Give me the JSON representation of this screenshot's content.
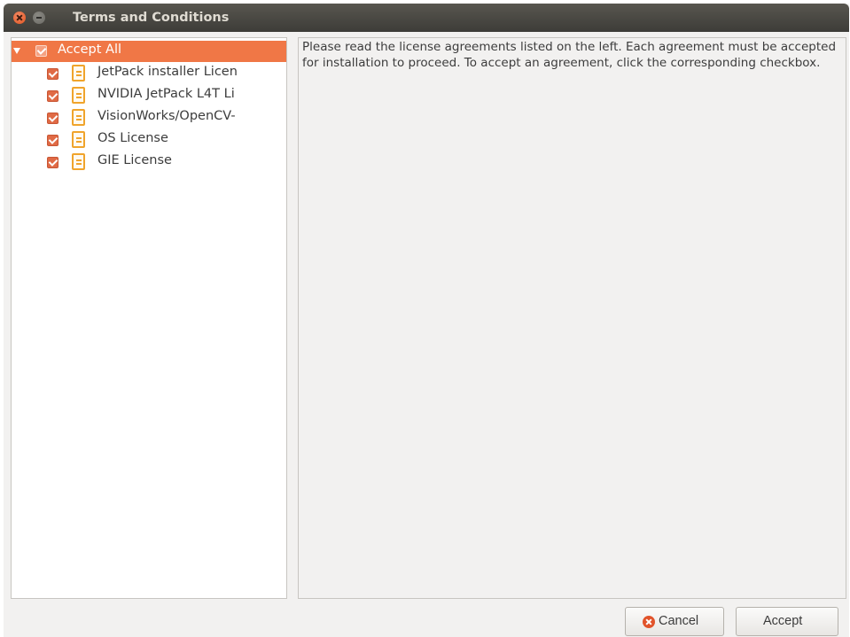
{
  "window": {
    "title": "Terms and Conditions"
  },
  "tree": {
    "root": {
      "label": "Accept All",
      "checked": true,
      "expanded": true,
      "selected": true
    },
    "items": [
      {
        "label": "JetPack installer Licen",
        "checked": true,
        "icon": "document-icon"
      },
      {
        "label": "NVIDIA JetPack L4T Li",
        "checked": true,
        "icon": "document-icon"
      },
      {
        "label": "VisionWorks/OpenCV-",
        "checked": true,
        "icon": "document-icon"
      },
      {
        "label": "OS License",
        "checked": true,
        "icon": "document-icon"
      },
      {
        "label": "GIE License",
        "checked": true,
        "icon": "document-icon"
      }
    ]
  },
  "info": {
    "text": "Please read the license agreements listed on the left. Each agreement must be accepted for installation to proceed. To accept an agreement, click the corresponding checkbox."
  },
  "buttons": {
    "cancel_label": "Cancel",
    "accept_label": "Accept"
  },
  "colors": {
    "accent": "#f07746",
    "titlebar": "#3d3c38",
    "checkbox": "#e06a45",
    "document_icon": "#f0a42c"
  }
}
